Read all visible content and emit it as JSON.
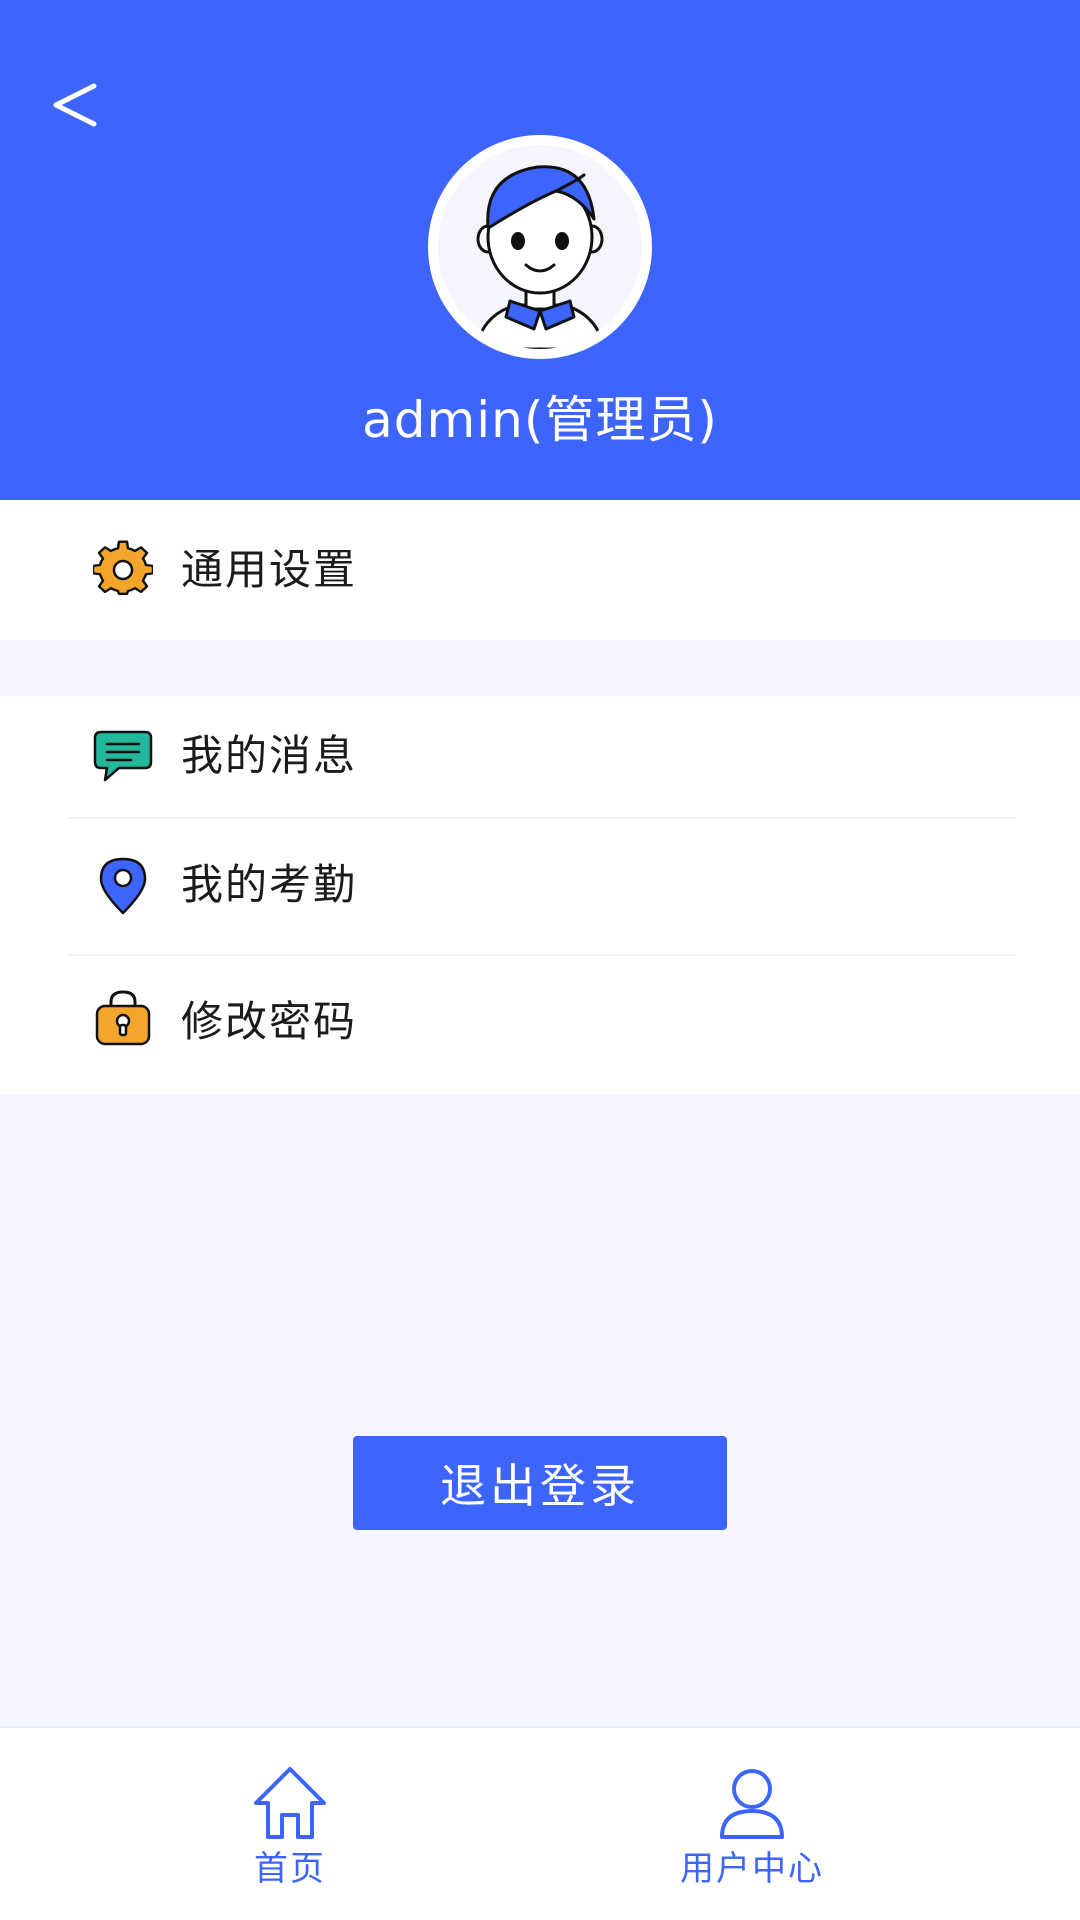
{
  "theme": {
    "primary": "#3d65fb",
    "background": "#f4f5fd",
    "gear_icon_color": "#f4a62a",
    "message_icon_color": "#23b79c",
    "location_icon_color": "#3d65fb",
    "lock_icon_color": "#f4a62a"
  },
  "header": {
    "back_label": "<",
    "username": "admin(管理员)"
  },
  "menu": {
    "general_settings": {
      "label": "通用设置",
      "icon": "gear-icon"
    },
    "my_messages": {
      "label": "我的消息",
      "icon": "message-icon"
    },
    "my_attendance": {
      "label": "我的考勤",
      "icon": "location-pin-icon"
    },
    "change_password": {
      "label": "修改密码",
      "icon": "lock-icon"
    }
  },
  "logout": {
    "label": "退出登录"
  },
  "bottom_nav": {
    "home": {
      "label": "首页",
      "icon": "home-icon"
    },
    "user_center": {
      "label": "用户中心",
      "icon": "user-icon",
      "active": true
    }
  }
}
